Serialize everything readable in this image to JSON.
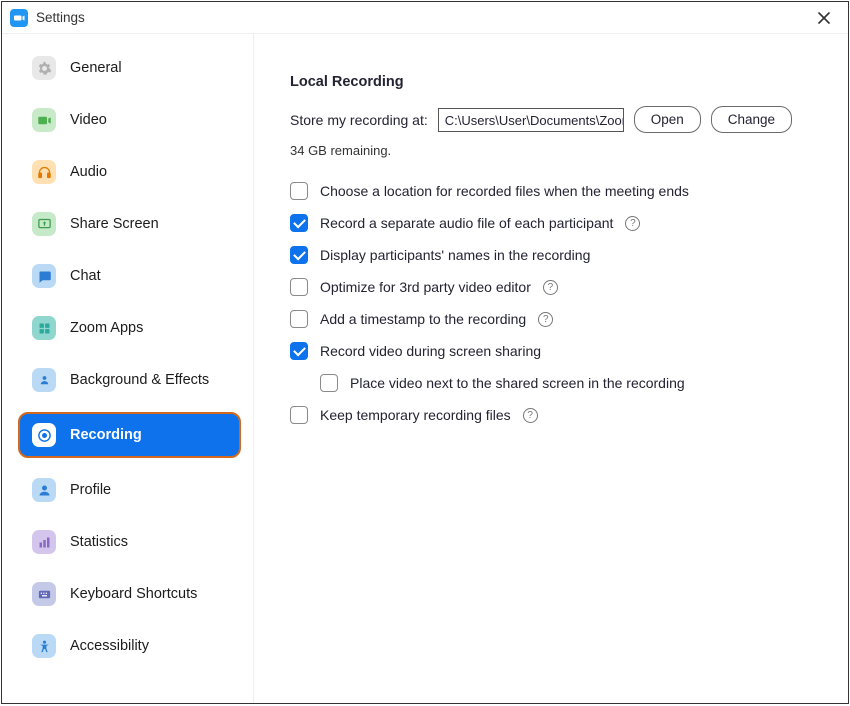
{
  "window": {
    "title": "Settings"
  },
  "sidebar": {
    "items": [
      {
        "id": "general",
        "label": "General"
      },
      {
        "id": "video",
        "label": "Video"
      },
      {
        "id": "audio",
        "label": "Audio"
      },
      {
        "id": "share-screen",
        "label": "Share Screen"
      },
      {
        "id": "chat",
        "label": "Chat"
      },
      {
        "id": "zoom-apps",
        "label": "Zoom Apps"
      },
      {
        "id": "background",
        "label": "Background & Effects"
      },
      {
        "id": "recording",
        "label": "Recording"
      },
      {
        "id": "profile",
        "label": "Profile"
      },
      {
        "id": "statistics",
        "label": "Statistics"
      },
      {
        "id": "keyboard",
        "label": "Keyboard Shortcuts"
      },
      {
        "id": "accessibility",
        "label": "Accessibility"
      }
    ],
    "active": "recording"
  },
  "content": {
    "section_title": "Local Recording",
    "store_label": "Store my recording at:",
    "store_path": "C:\\Users\\User\\Documents\\Zoom",
    "open_label": "Open",
    "change_label": "Change",
    "remaining": "34 GB remaining.",
    "options": [
      {
        "id": "choose-location",
        "label": "Choose a location for recorded files when the meeting ends",
        "checked": false,
        "help": false,
        "indent": false
      },
      {
        "id": "separate-audio",
        "label": "Record a separate audio file of each participant",
        "checked": true,
        "help": true,
        "indent": false
      },
      {
        "id": "display-names",
        "label": "Display participants' names in the recording",
        "checked": true,
        "help": false,
        "indent": false
      },
      {
        "id": "optimize-3rd",
        "label": "Optimize for 3rd party video editor",
        "checked": false,
        "help": true,
        "indent": false
      },
      {
        "id": "timestamp",
        "label": "Add a timestamp to the recording",
        "checked": false,
        "help": true,
        "indent": false
      },
      {
        "id": "record-screen-share",
        "label": "Record video during screen sharing",
        "checked": true,
        "help": false,
        "indent": false
      },
      {
        "id": "place-video-next",
        "label": "Place video next to the shared screen in the recording",
        "checked": false,
        "help": false,
        "indent": true
      },
      {
        "id": "keep-temp",
        "label": "Keep temporary recording files",
        "checked": false,
        "help": true,
        "indent": false
      }
    ]
  }
}
